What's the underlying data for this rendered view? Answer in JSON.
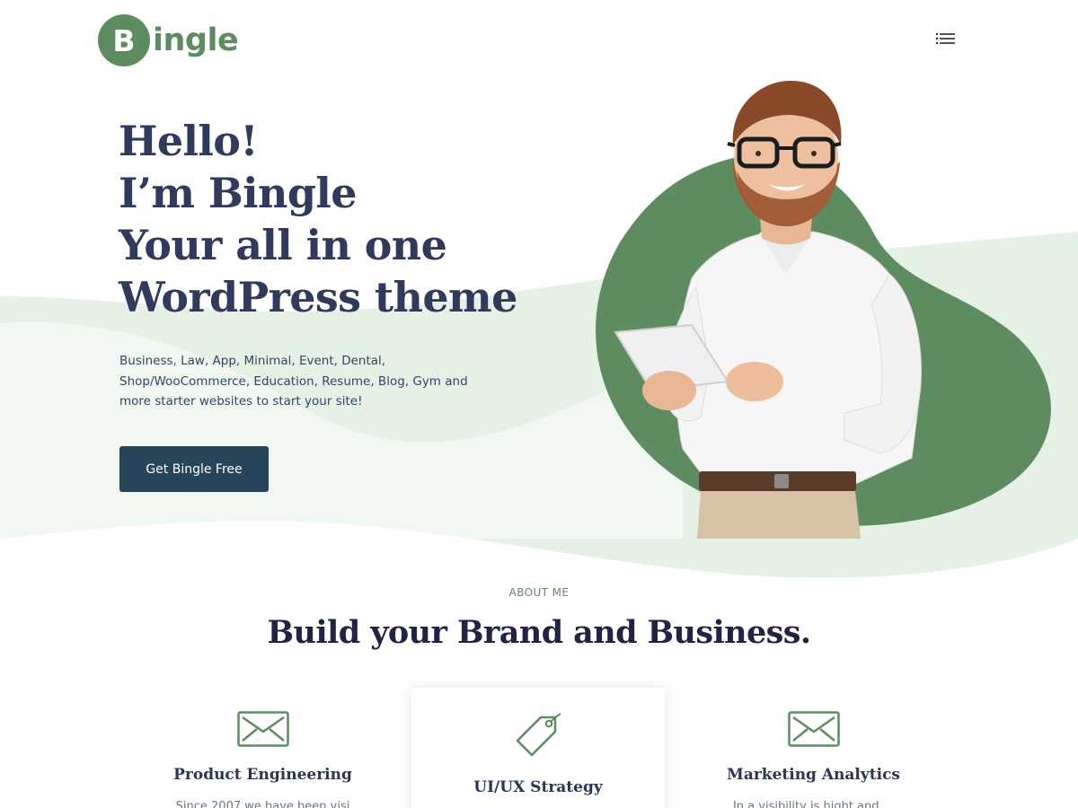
{
  "brand": {
    "logo_letter": "B",
    "logo_text": "ingle",
    "accent_color": "#5e8c61",
    "dark_color": "#26445a"
  },
  "header": {
    "menu_icon": "hamburger-menu-icon"
  },
  "hero": {
    "title_lines": [
      "Hello!",
      "I’m Bingle",
      "Your all in one",
      "WordPress theme"
    ],
    "description_lines": [
      "Business, Law, App, Minimal, Event, Dental,",
      "Shop/WooCommerce, Education, Resume, Blog, Gym and",
      "more starter websites  to start your site!"
    ],
    "cta_label": "Get Bingle Free"
  },
  "about": {
    "eyebrow": "ABOUT ME",
    "title": "Build your Brand and Business."
  },
  "services": [
    {
      "icon": "envelope-icon",
      "title": "Product Engineering",
      "text": "Since 2007 we have been visi"
    },
    {
      "icon": "price-tag-icon",
      "title": "UI/UX Strategy",
      "text": ""
    },
    {
      "icon": "envelope-icon",
      "title": "Marketing Analytics",
      "text": "In a visibility is hight and ..."
    }
  ]
}
